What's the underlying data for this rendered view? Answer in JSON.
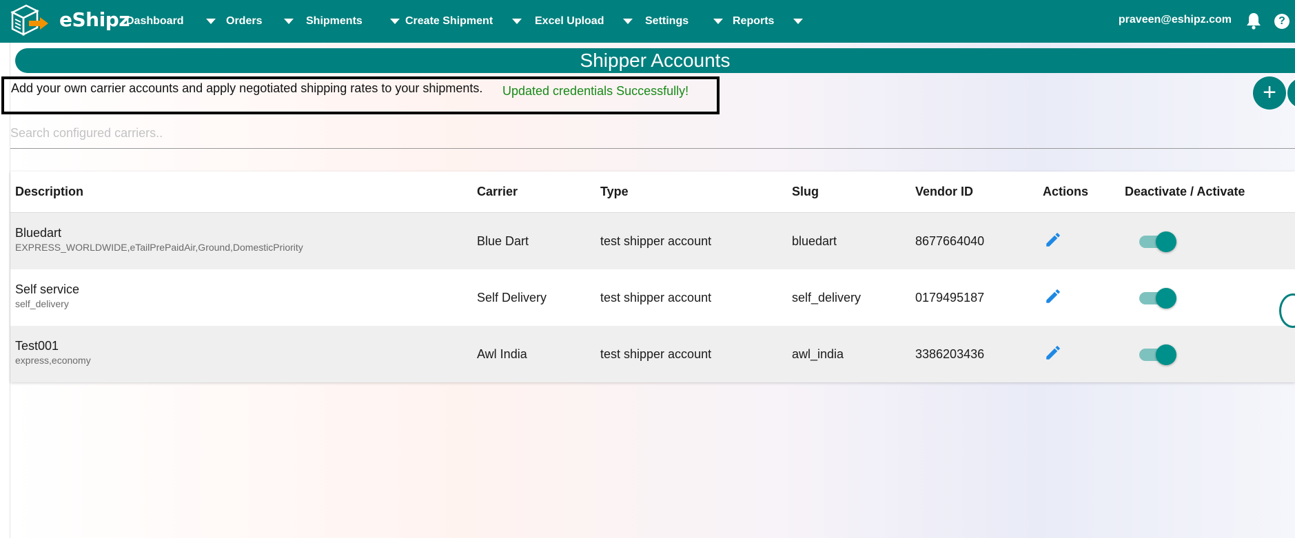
{
  "brand": {
    "name": "eShipz"
  },
  "nav": {
    "items": [
      {
        "label": "Dashboard"
      },
      {
        "label": "Orders"
      },
      {
        "label": "Shipments"
      },
      {
        "label": "Create Shipment"
      },
      {
        "label": "Excel Upload"
      },
      {
        "label": "Settings"
      },
      {
        "label": "Reports"
      }
    ],
    "user_email": "praveen@eshipz.com",
    "help_label": "?"
  },
  "page": {
    "title": "Shipper Accounts",
    "info_text": "Add your own carrier accounts and apply negotiated shipping rates to your shipments.",
    "success_message": "Updated credentials Successfully!",
    "add_button_label": "+",
    "search_placeholder": "Search configured carriers.."
  },
  "table": {
    "headers": [
      "Description",
      "Carrier",
      "Type",
      "Slug",
      "Vendor ID",
      "Actions",
      "Deactivate / Activate"
    ],
    "rows": [
      {
        "description": "Bluedart",
        "services": "EXPRESS_WORLDWIDE,eTailPrePaidAir,Ground,DomesticPriority",
        "carrier": "Blue Dart",
        "type": "test shipper account",
        "slug": "bluedart",
        "vendor_id": "8677664040",
        "active": true
      },
      {
        "description": "Self service",
        "services": "self_delivery",
        "carrier": "Self Delivery",
        "type": "test shipper account",
        "slug": "self_delivery",
        "vendor_id": "0179495187",
        "active": true
      },
      {
        "description": "Test001",
        "services": "express,economy",
        "carrier": "Awl India",
        "type": "test shipper account",
        "slug": "awl_india",
        "vendor_id": "3386203436",
        "active": true
      }
    ]
  },
  "colors": {
    "primary": "#00807e",
    "success": "#178a17",
    "edit_icon": "#1e88e5"
  }
}
